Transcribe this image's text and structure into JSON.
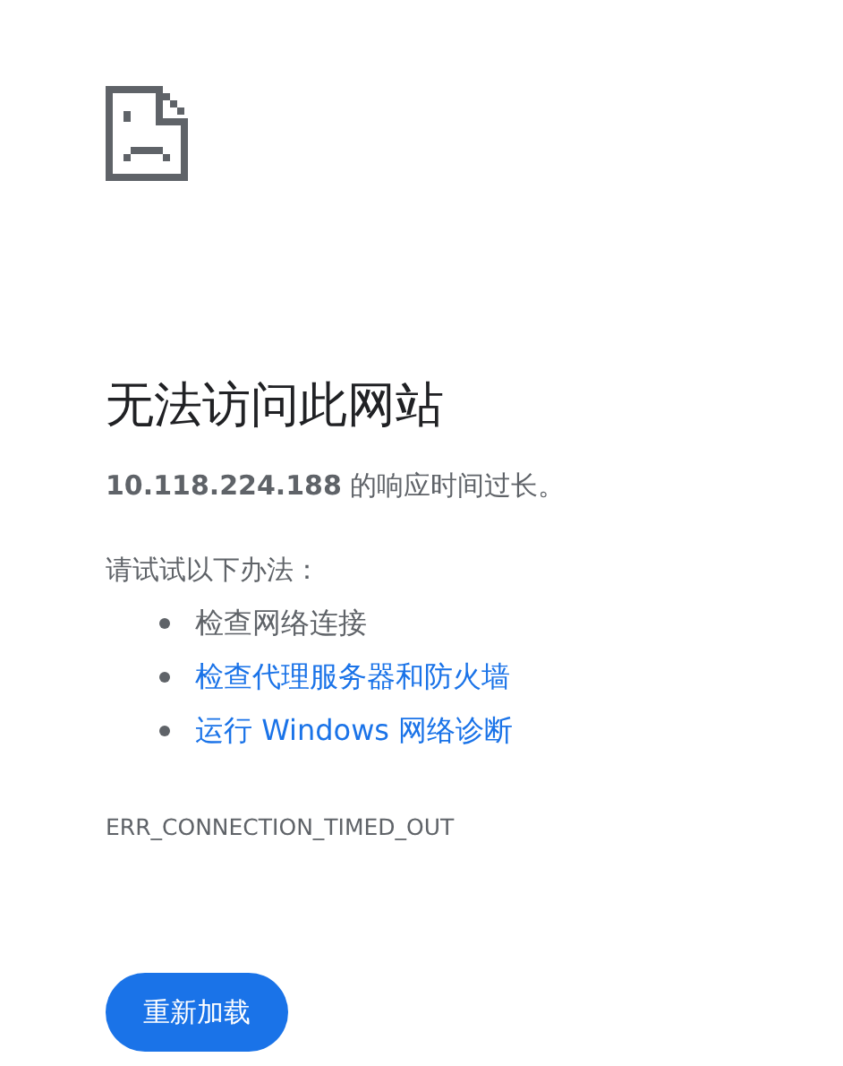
{
  "title": "无法访问此网站",
  "detail": "**10.118.224.188** 的响应时间过长。",
  "suggestions_heading": "请试试以下办法：",
  "suggestions": [
    {
      "kind": "text",
      "label": "检查网络连接"
    },
    {
      "kind": "link",
      "label": "检查代理服务器和防火墙"
    },
    {
      "kind": "link",
      "label": "运行 Windows 网络诊断"
    }
  ],
  "error_code": "ERR_CONNECTION_TIMED_OUT",
  "buttons": [
    "重新加载"
  ]
}
